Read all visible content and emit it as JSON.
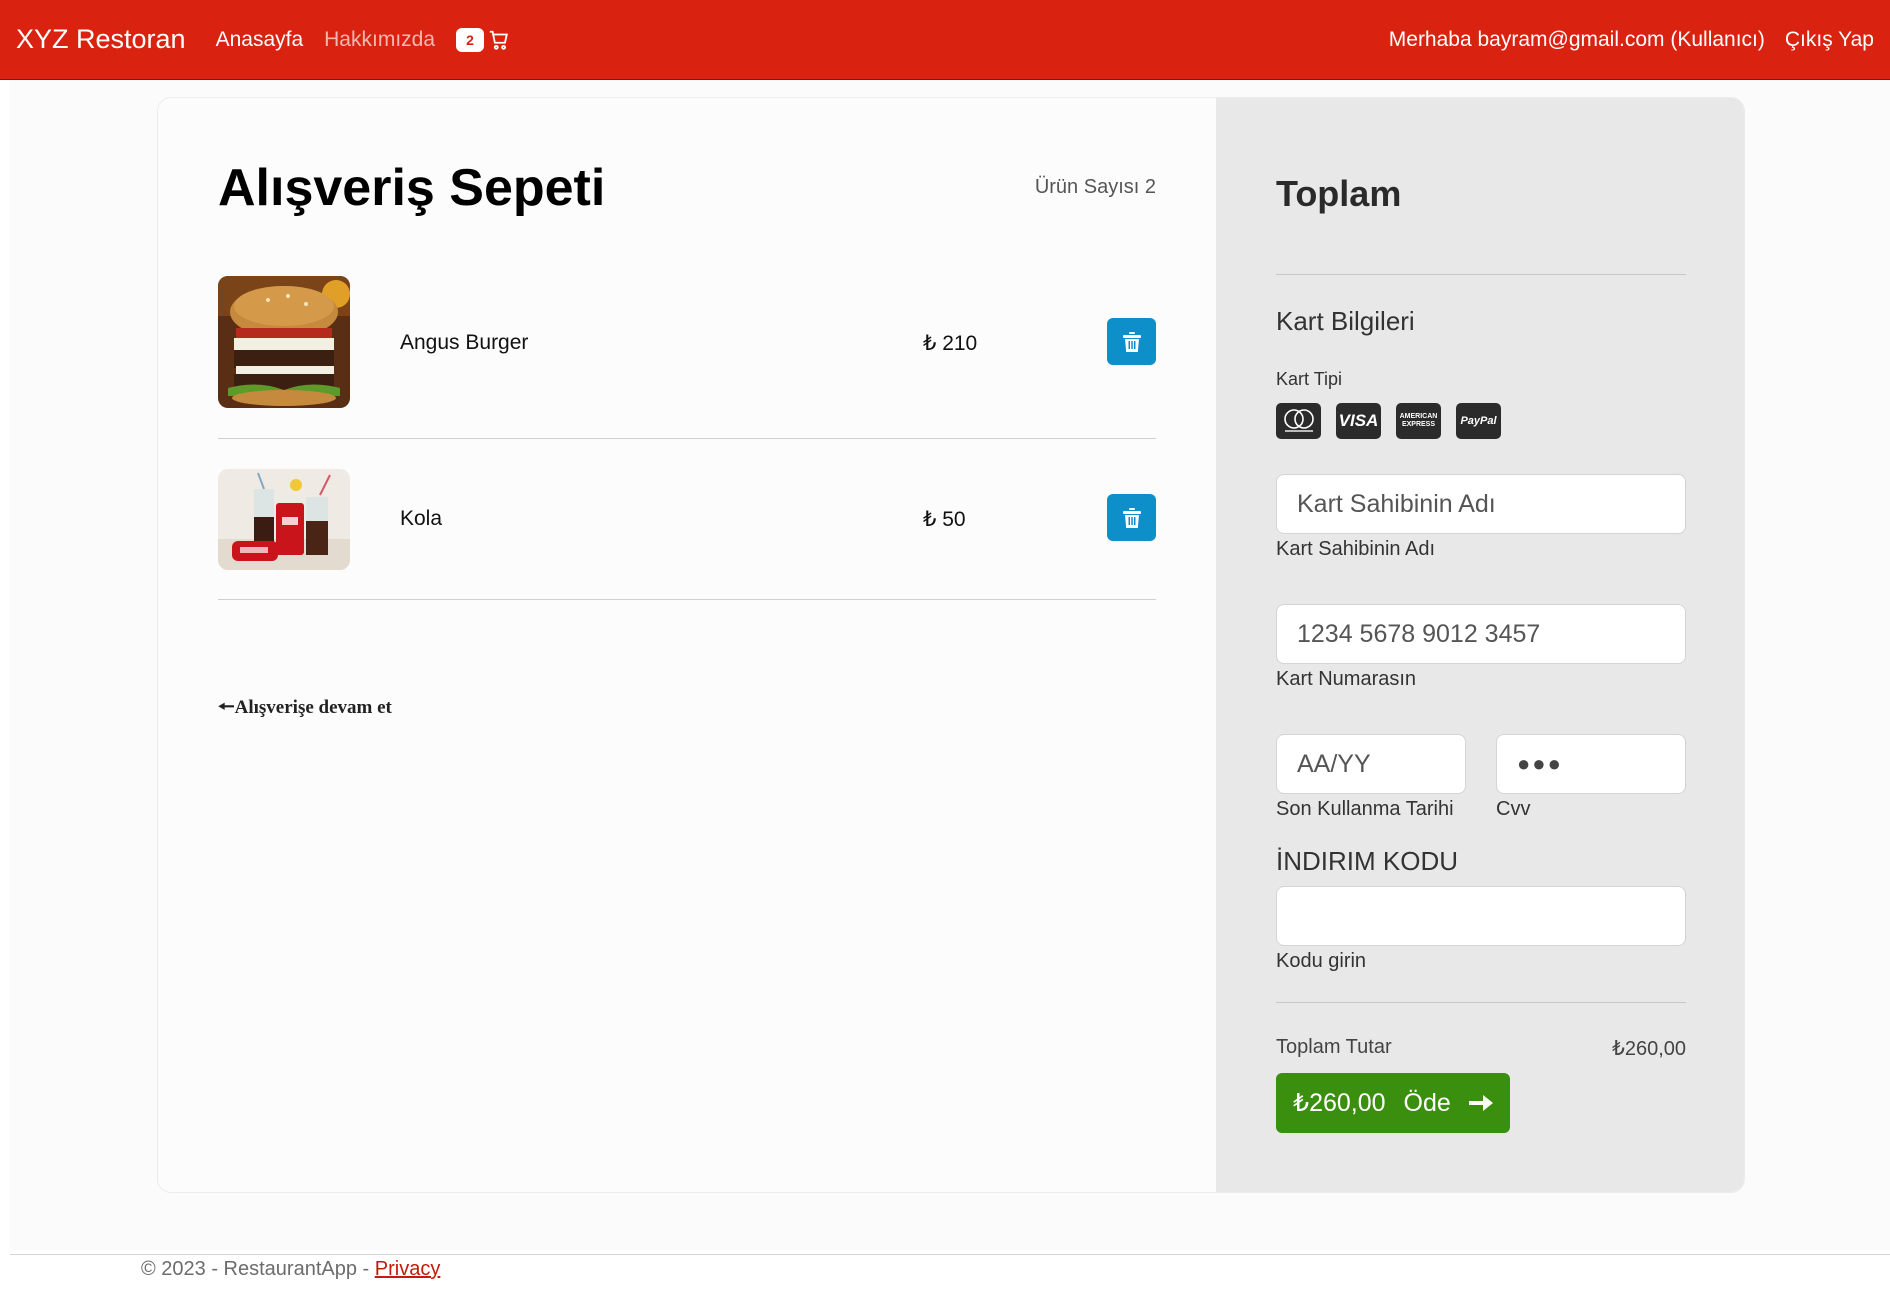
{
  "navbar": {
    "brand": "XYZ Restoran",
    "home": "Anasayfa",
    "about": "Hakkımızda",
    "cart_count": "2",
    "greeting": "Merhaba bayram@gmail.com (Kullanıcı)",
    "logout": "Çıkış Yap"
  },
  "cart": {
    "title": "Alışveriş Sepeti",
    "item_count": "Ürün Sayısı 2",
    "items": [
      {
        "name": "Angus Burger",
        "price": "₺ 210"
      },
      {
        "name": "Kola",
        "price": "₺ 50"
      }
    ],
    "continue_label": "🠔Alışverişe devam et"
  },
  "summary": {
    "title": "Toplam",
    "card_info_title": "Kart Bilgileri",
    "card_type_label": "Kart Tipi",
    "card_types": [
      "mastercard",
      "VISA",
      "AMERICAN EXPRESS",
      "PayPal"
    ],
    "holder_placeholder": "Kart Sahibinin Adı",
    "holder_label": "Kart Sahibinin Adı",
    "number_placeholder": "1234 5678 9012 3457",
    "number_label": "Kart Numarasın",
    "expiry_placeholder": "AA/YY",
    "expiry_label": "Son Kullanma Tarihi",
    "cvv_placeholder": "●●●",
    "cvv_label": "Cvv",
    "discount_title": "İNDIRIM KODU",
    "discount_label": "Kodu girin",
    "total_label": "Toplam Tutar",
    "total_value": "₺260,00",
    "pay_amount": "₺260,00",
    "pay_label": "Öde"
  },
  "footer": {
    "copyright": "© 2023 - RestaurantApp - ",
    "privacy": "Privacy"
  },
  "colors": {
    "navbar": "#d9220f",
    "delete_button": "#0d8fc9",
    "pay_button": "#3b8f0f",
    "summary_bg": "#e9e8e8"
  }
}
